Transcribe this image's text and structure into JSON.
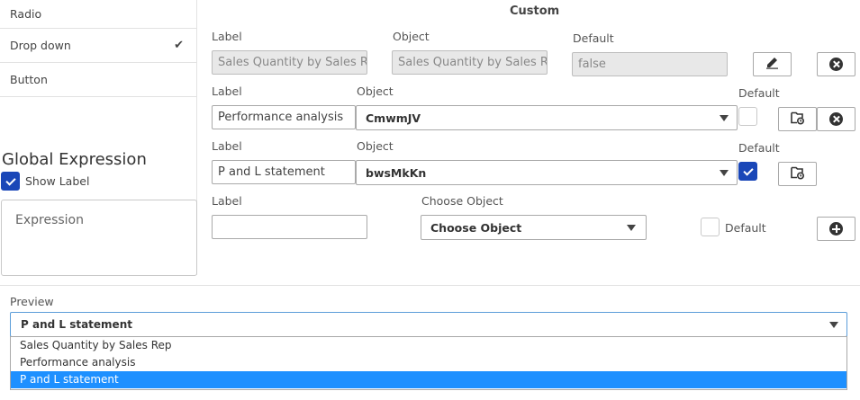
{
  "menu": {
    "items": [
      {
        "label": "Radio"
      },
      {
        "label": "Drop down",
        "checked": true
      },
      {
        "label": "Button"
      }
    ]
  },
  "global": {
    "title": "Global Expression",
    "show_label": "Show Label",
    "show_label_checked": true,
    "expression_placeholder": "Expression"
  },
  "custom": {
    "title": "Custom",
    "rows": [
      {
        "label_caption": "Label",
        "object_caption": "Object",
        "default_caption": "Default",
        "label_value": "Sales Quantity by Sales R",
        "object_value": "Sales Quantity by Sales R",
        "default_value": "false",
        "icons": [
          "edit-icon",
          "close-circle-icon"
        ]
      },
      {
        "label_caption": "Label",
        "object_caption": "Object",
        "default_caption": "Default",
        "label_value": "Performance analysis",
        "object_value": "CmwmJV",
        "default_checked": false,
        "icons": [
          "table-settings-icon",
          "close-circle-icon"
        ]
      },
      {
        "label_caption": "Label",
        "object_caption": "Object",
        "default_caption": "Default",
        "label_value": "P and L statement",
        "object_value": "bwsMkKn",
        "default_checked": true,
        "icons": [
          "table-settings-icon"
        ]
      }
    ],
    "new_row": {
      "label_caption": "Label",
      "object_caption": "Choose Object",
      "object_value": "Choose Object",
      "default_caption": "Default",
      "label_value": "",
      "icons": [
        "add-circle-icon"
      ]
    }
  },
  "preview": {
    "caption": "Preview",
    "selected": "P and L statement",
    "options": [
      "Sales Quantity by Sales Rep",
      "Performance analysis",
      "P and L statement"
    ]
  }
}
